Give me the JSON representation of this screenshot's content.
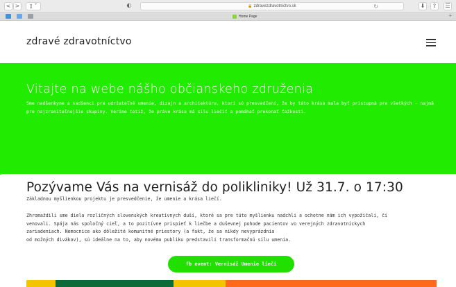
{
  "browser": {
    "url": "zdravezdravotnictvo.sk",
    "tab_title": "Home Page",
    "nav_back": "<",
    "nav_forward": ">",
    "sidebar_toggle": "▯ ˅",
    "reader_icon": "◐",
    "reload_icon": "↻",
    "download_icon": "⬇",
    "share_icon": "⇪",
    "tabs_icon": "☰",
    "new_tab": "+"
  },
  "header": {
    "brand": "zdravé zdravotníctvo"
  },
  "hero": {
    "title": "Vitajte na webe nášho občianskeho združenia",
    "text": "Sme nadšenkyne a nadšenci pre udržateľné umenie, dizajn a architektúru, ktorí sú presvedčení, že by táto krása mala byť prístupná pre všetkých - najmä pre najzraniteľnejšie skupiny. Veríme totiž, že práve krása má silu liečiť a pomáhať prekonať ťažkosti."
  },
  "article": {
    "title": "Pozývame Vás na vernisáž do polikliniky! Už 31.7. o 17:30",
    "lead": "Základnou myšlienkou projektu je presvedčenie, že umenie a krása liečí.",
    "body_line1": "Zhromaždili sme diela rozličných slovenských kreatívnych duší, ktoré sa pre túto myšlienku nadchli a ochotne nám ich vypožičali, či",
    "body_line2": "venovali. Spája nás spoločný cieľ, a to pozitívne prispieť k liečbe a duševnej pohode pacientov vo verejných zdravotníckych",
    "body_line3": "zariadeniach. Nemocnice ako dôležité komunitné priestory (a fakt, že sa nikdy nevyprázdnia",
    "body_line4": "od možných divákov), sú ideálne na to, aby novému publiku predstavili transformačnú silu umenia.",
    "button_label": "fb event: Vernisáž Umenie lieči"
  },
  "colors": {
    "accent_green": "#21ec00",
    "strip": [
      "#f2c500",
      "#0d6b3a",
      "#f2c500",
      "#ff6a1a"
    ]
  }
}
